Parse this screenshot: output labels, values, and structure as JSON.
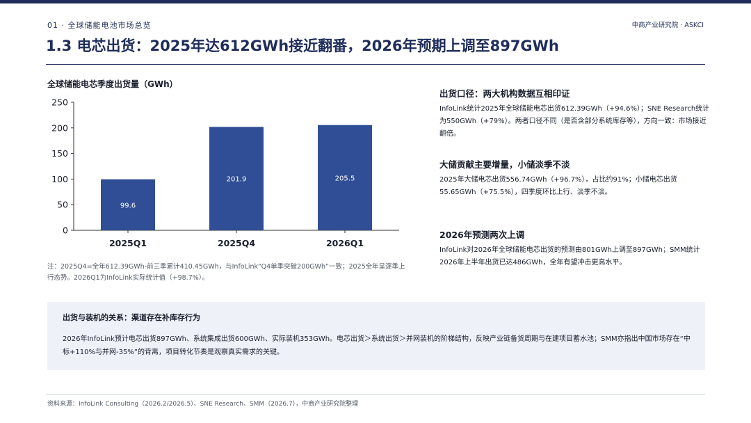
{
  "header": {
    "section": "01 · 全球储能电池市场总览",
    "brand": "中商产业研究院 · ASKCI",
    "title": "1.3 电芯出货：2025年达612GWh接近翻番，2026年预期上调至897GWh"
  },
  "chart_data": {
    "type": "bar",
    "title": "全球储能电芯季度出货量（GWh）",
    "categories": [
      "2025Q1",
      "2025Q4",
      "2026Q1"
    ],
    "values": [
      99.6,
      201.9,
      205.5
    ],
    "data_labels": [
      "99.6",
      "201.9",
      "205.5"
    ],
    "ylim": [
      0,
      250
    ],
    "yticks": [
      0,
      50,
      100,
      150,
      200,
      250
    ],
    "xlabel": "",
    "ylabel": "",
    "grid": false,
    "bar_color": "#2f4e96",
    "note": "注：2025Q4=全年612.39GWh-前三季累计410.45GWh，与InfoLink“Q4单季突破200GWh”一致；2025全年呈逐季上行态势。2026Q1为InfoLink实际统计值（+98.7%）。"
  },
  "right_panel": {
    "sections": [
      {
        "heading": "出货口径：两大机构数据互相印证",
        "text": "InfoLink统计2025年全球储能电芯出货612.39GWh（+94.6%）；SNE Research统计为550GWh（+79%）。两者口径不同（是否含部分系统库存等），方向一致：市场接近翻倍。"
      },
      {
        "heading": "大储贡献主要增量，小储淡季不淡",
        "text": "2025年大储电芯出货556.74GWh（+96.7%），占比约91%；小储电芯出货55.65GWh（+75.5%），四季度环比上行、淡季不淡。"
      },
      {
        "heading": "2026年预测两次上调",
        "text": "InfoLink对2026年全球储能电芯出货的预测由801GWh上调至897GWh；SMM统计2026年上半年出货已达486GWh，全年有望冲击更高水平。"
      }
    ]
  },
  "callout": {
    "heading": "出货与装机的关系：渠道存在补库存行为",
    "text": "2026年InfoLink预计电芯出货897GWh、系统集成出货600GWh、实际装机353GWh。电芯出货＞系统出货＞并网装机的阶梯结构，反映产业链备货周期与在建项目蓄水池；SMM亦指出中国市场存在“中标+110%与并网-35%”的背离，项目转化节奏是观察真实需求的关键。"
  },
  "footer": {
    "source": "资料来源：InfoLink Consulting（2026.2/2026.5）、SNE Research、SMM（2026.7），中商产业研究院整理"
  },
  "colors": {
    "navy": "#1f2d5a",
    "bar": "#2f4e96",
    "callout_bg": "#eef1f8"
  }
}
